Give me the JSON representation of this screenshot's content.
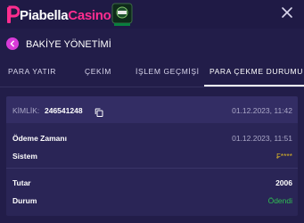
{
  "header": {
    "logo_text_1": "Piabella",
    "logo_text_2": "Casino"
  },
  "titlebar": {
    "title": "BAKİYE YÖNETİMİ"
  },
  "tabs": [
    {
      "label": "PARA YATIR"
    },
    {
      "label": "ÇEKİM"
    },
    {
      "label": "İŞLEM GEÇMİŞİ"
    },
    {
      "label": "PARA ÇEKME DURUMU"
    }
  ],
  "card": {
    "id_label": "KİMLİK:",
    "id_value": "246541248",
    "header_datetime": "01.12.2023, 11:42",
    "rows": [
      {
        "label": "Ödeme Zamanı",
        "value": "01.12.2023, 11:51"
      },
      {
        "label": "Sistem",
        "value": "₣****"
      },
      {
        "label": "Tutar",
        "value": "2006"
      },
      {
        "label": "Durum",
        "value": "Ödendi"
      }
    ]
  },
  "colors": {
    "background": "#221d49",
    "accent": "#d83bd8",
    "brand_pink": "#ff2d8f",
    "status_paid": "#2fbf53",
    "system_gold": "#d7b227"
  },
  "icons": {
    "close": "close-icon",
    "back": "chevron-left-icon",
    "copy": "copy-icon"
  }
}
